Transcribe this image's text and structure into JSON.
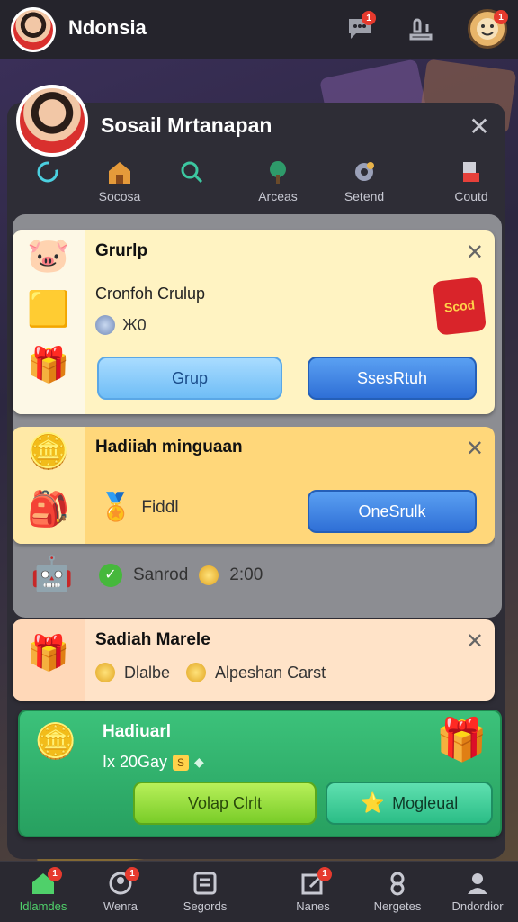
{
  "header": {
    "title": "Ndonsia",
    "icons": [
      {
        "name": "chat-icon",
        "badge": "1"
      },
      {
        "name": "sofa-icon",
        "badge": ""
      },
      {
        "name": "profile-face-icon",
        "badge": "1"
      }
    ]
  },
  "panel": {
    "title": "Sosail Mrtanapan",
    "close": "✕",
    "tabs": [
      {
        "label": "",
        "icon": "refresh-icon"
      },
      {
        "label": "Socosa",
        "icon": "house-icon"
      },
      {
        "label": "",
        "icon": "search-icon"
      },
      {
        "label": "Arceas",
        "icon": "tree-icon"
      },
      {
        "label": "Setend",
        "icon": "gear-icon"
      },
      {
        "label": "Coutd",
        "icon": "flag-icon"
      }
    ]
  },
  "cards": {
    "group": {
      "title": "Grurlp",
      "subtitle": "Cronfoh Crulup",
      "count": "Ж0",
      "btn_left": "Grup",
      "btn_right": "SsesRtuh",
      "prize_label": "Scod"
    },
    "weekly": {
      "title": "Hadiiah minguaan",
      "reward": "Fiddl",
      "btn": "OneSrulk",
      "status_label": "Sanrod",
      "time": "2:00"
    },
    "special": {
      "title": "Sadiah Marele",
      "item1": "Dlalbe",
      "item2": "Alpeshan Carst"
    },
    "daily": {
      "title": "Hadiuarl",
      "text": "Ix 20Gay",
      "coin_mark": "S",
      "btn_left": "Volap Clrlt",
      "btn_right": "Mogleual"
    }
  },
  "nav": [
    {
      "label": "Idlamdes",
      "icon": "home-icon",
      "badge": "1"
    },
    {
      "label": "Wenra",
      "icon": "people-icon",
      "badge": "1"
    },
    {
      "label": "Segords",
      "icon": "list-icon",
      "badge": ""
    },
    {
      "label": "Nanes",
      "icon": "edit-icon",
      "badge": "1"
    },
    {
      "label": "Nergetes",
      "icon": "badge-icon",
      "badge": ""
    },
    {
      "label": "Dndordior",
      "icon": "user-icon",
      "badge": ""
    }
  ],
  "colors": {
    "accent_cyan": "#4bd0e0",
    "button_blue": "#3f86e8",
    "button_green": "#8fdc3c",
    "daily_green": "#2fae68",
    "badge_red": "#e63a2e"
  }
}
